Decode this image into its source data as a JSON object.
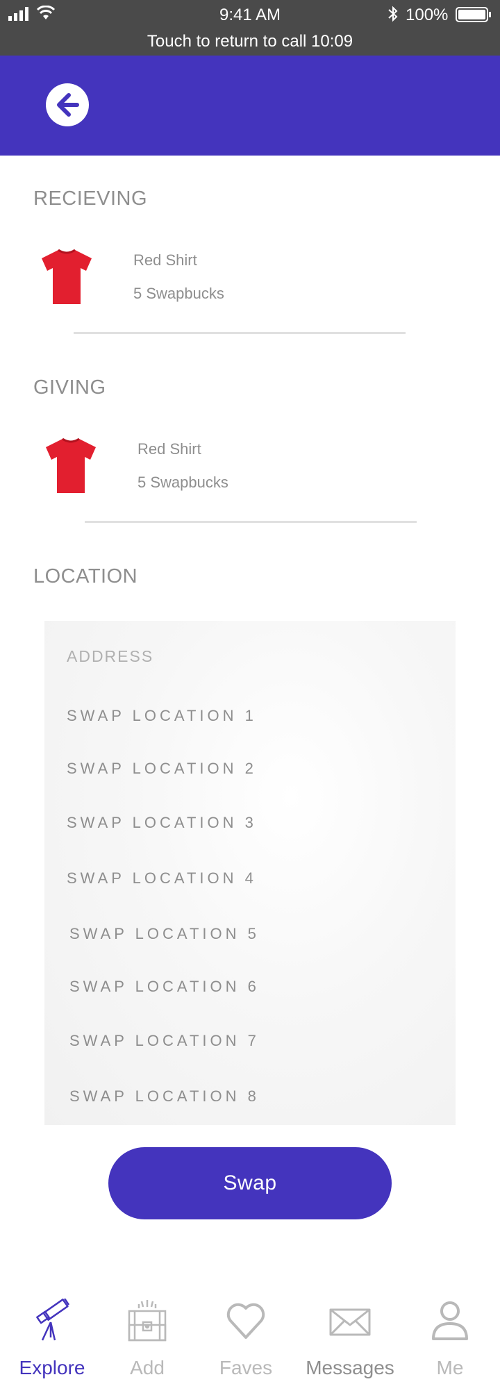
{
  "status_bar": {
    "time": "9:41 AM",
    "battery": "100%",
    "call_banner": "Touch to return to call 10:09",
    "icons": [
      "signal-icon",
      "wifi-icon",
      "bluetooth-icon",
      "battery-icon"
    ]
  },
  "header": {
    "back_icon": "arrow-left-icon",
    "accent_color": "#4434bd"
  },
  "receiving": {
    "heading": "RECIEVING",
    "item": {
      "name": "Red Shirt",
      "price": "5 Swapbucks",
      "image": "red-shirt-image"
    }
  },
  "giving": {
    "heading": "GIVING",
    "item": {
      "name": "Red Shirt",
      "price": "5 Swapbucks",
      "image": "red-shirt-image"
    }
  },
  "location": {
    "heading": "LOCATION",
    "address_label": "ADDRESS",
    "options": [
      "SWAP LOCATION 1",
      "SWAP LOCATION 2",
      "SWAP LOCATION 3",
      "SWAP LOCATION 4",
      "SWAP LOCATION 5",
      "SWAP LOCATION 6",
      "SWAP LOCATION 7",
      "SWAP LOCATION 8"
    ]
  },
  "swap_button": {
    "label": "Swap"
  },
  "tab_bar": {
    "tabs": [
      {
        "label": "Explore",
        "icon": "telescope-icon",
        "active": true
      },
      {
        "label": "Add",
        "icon": "treasure-chest-icon",
        "active": false
      },
      {
        "label": "Faves",
        "icon": "heart-icon",
        "active": false
      },
      {
        "label": "Messages",
        "icon": "envelope-icon",
        "active": false
      },
      {
        "label": "Me",
        "icon": "user-icon",
        "active": false
      }
    ]
  },
  "colors": {
    "accent": "#4434bd",
    "status_bar": "#4a4a4a",
    "shirt": "#e21f2f",
    "text_gray": "#8e8e8e"
  }
}
